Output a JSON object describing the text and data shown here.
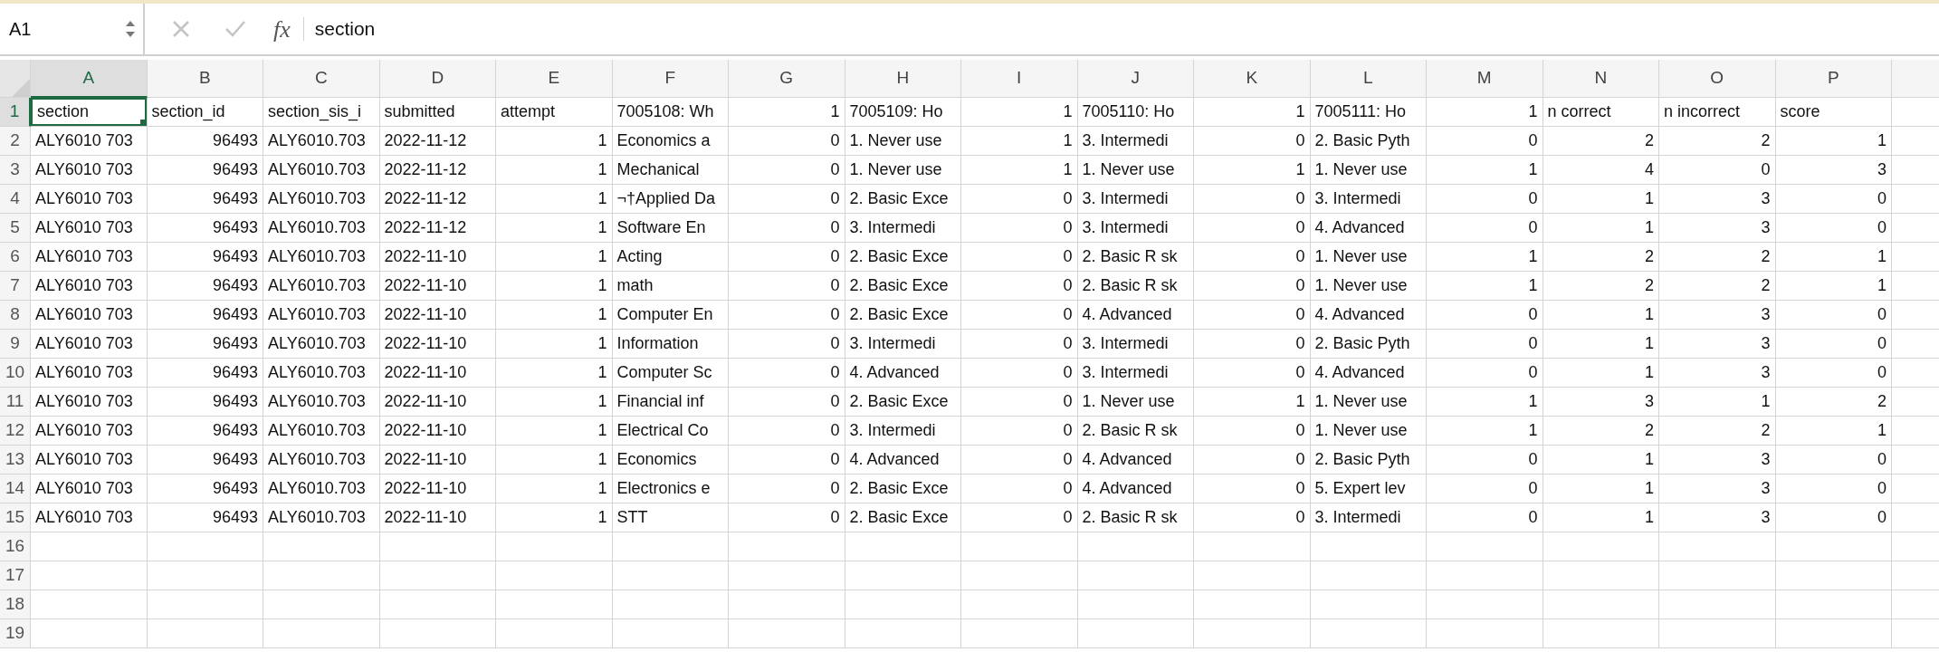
{
  "formula_bar": {
    "name_box": "A1",
    "function_label": "fx",
    "formula": "section"
  },
  "columns": [
    {
      "label": "A",
      "selected": true
    },
    {
      "label": "B",
      "selected": false
    },
    {
      "label": "C",
      "selected": false
    },
    {
      "label": "D",
      "selected": false
    },
    {
      "label": "E",
      "selected": false
    },
    {
      "label": "F",
      "selected": false
    },
    {
      "label": "G",
      "selected": false
    },
    {
      "label": "H",
      "selected": false
    },
    {
      "label": "I",
      "selected": false
    },
    {
      "label": "J",
      "selected": false
    },
    {
      "label": "K",
      "selected": false
    },
    {
      "label": "L",
      "selected": false
    },
    {
      "label": "M",
      "selected": false
    },
    {
      "label": "N",
      "selected": false
    },
    {
      "label": "O",
      "selected": false
    },
    {
      "label": "P",
      "selected": false
    }
  ],
  "rows": [
    {
      "number": "1",
      "selected": true,
      "cells": [
        {
          "text": "section",
          "kind": "text"
        },
        {
          "text": "section_id",
          "kind": "text"
        },
        {
          "text": "section_sis_i",
          "kind": "text"
        },
        {
          "text": "submitted",
          "kind": "text"
        },
        {
          "text": "attempt",
          "kind": "text"
        },
        {
          "text": "7005108: Wh",
          "kind": "text"
        },
        {
          "text": "1",
          "kind": "number"
        },
        {
          "text": "7005109: Ho",
          "kind": "text"
        },
        {
          "text": "1",
          "kind": "number"
        },
        {
          "text": "7005110: Ho",
          "kind": "text"
        },
        {
          "text": "1",
          "kind": "number"
        },
        {
          "text": "7005111: Ho",
          "kind": "text"
        },
        {
          "text": "1",
          "kind": "number"
        },
        {
          "text": "n correct",
          "kind": "text"
        },
        {
          "text": "n incorrect",
          "kind": "text"
        },
        {
          "text": "score",
          "kind": "text"
        }
      ]
    },
    {
      "number": "2",
      "selected": false,
      "cells": [
        {
          "text": "ALY6010 703",
          "kind": "text"
        },
        {
          "text": "96493",
          "kind": "number"
        },
        {
          "text": "ALY6010.703",
          "kind": "text"
        },
        {
          "text": "2022-11-12",
          "kind": "text"
        },
        {
          "text": "1",
          "kind": "number"
        },
        {
          "text": "Economics a",
          "kind": "text"
        },
        {
          "text": "0",
          "kind": "number"
        },
        {
          "text": "1. Never use",
          "kind": "text"
        },
        {
          "text": "1",
          "kind": "number"
        },
        {
          "text": "3. Intermedi",
          "kind": "text"
        },
        {
          "text": "0",
          "kind": "number"
        },
        {
          "text": "2. Basic Pyth",
          "kind": "text"
        },
        {
          "text": "0",
          "kind": "number"
        },
        {
          "text": "2",
          "kind": "number"
        },
        {
          "text": "2",
          "kind": "number"
        },
        {
          "text": "1",
          "kind": "number"
        }
      ]
    },
    {
      "number": "3",
      "selected": false,
      "cells": [
        {
          "text": "ALY6010 703",
          "kind": "text"
        },
        {
          "text": "96493",
          "kind": "number"
        },
        {
          "text": "ALY6010.703",
          "kind": "text"
        },
        {
          "text": "2022-11-12",
          "kind": "text"
        },
        {
          "text": "1",
          "kind": "number"
        },
        {
          "text": "Mechanical",
          "kind": "text"
        },
        {
          "text": "0",
          "kind": "number"
        },
        {
          "text": "1. Never use",
          "kind": "text"
        },
        {
          "text": "1",
          "kind": "number"
        },
        {
          "text": "1. Never use",
          "kind": "text"
        },
        {
          "text": "1",
          "kind": "number"
        },
        {
          "text": "1. Never use",
          "kind": "text"
        },
        {
          "text": "1",
          "kind": "number"
        },
        {
          "text": "4",
          "kind": "number"
        },
        {
          "text": "0",
          "kind": "number"
        },
        {
          "text": "3",
          "kind": "number"
        }
      ]
    },
    {
      "number": "4",
      "selected": false,
      "cells": [
        {
          "text": "ALY6010 703",
          "kind": "text"
        },
        {
          "text": "96493",
          "kind": "number"
        },
        {
          "text": "ALY6010.703",
          "kind": "text"
        },
        {
          "text": "2022-11-12",
          "kind": "text"
        },
        {
          "text": "1",
          "kind": "number"
        },
        {
          "text": "¬†Applied Da",
          "kind": "text"
        },
        {
          "text": "0",
          "kind": "number"
        },
        {
          "text": "2. Basic Exce",
          "kind": "text"
        },
        {
          "text": "0",
          "kind": "number"
        },
        {
          "text": "3. Intermedi",
          "kind": "text"
        },
        {
          "text": "0",
          "kind": "number"
        },
        {
          "text": "3. Intermedi",
          "kind": "text"
        },
        {
          "text": "0",
          "kind": "number"
        },
        {
          "text": "1",
          "kind": "number"
        },
        {
          "text": "3",
          "kind": "number"
        },
        {
          "text": "0",
          "kind": "number"
        }
      ]
    },
    {
      "number": "5",
      "selected": false,
      "cells": [
        {
          "text": "ALY6010 703",
          "kind": "text"
        },
        {
          "text": "96493",
          "kind": "number"
        },
        {
          "text": "ALY6010.703",
          "kind": "text"
        },
        {
          "text": "2022-11-12",
          "kind": "text"
        },
        {
          "text": "1",
          "kind": "number"
        },
        {
          "text": "Software En",
          "kind": "text"
        },
        {
          "text": "0",
          "kind": "number"
        },
        {
          "text": "3. Intermedi",
          "kind": "text"
        },
        {
          "text": "0",
          "kind": "number"
        },
        {
          "text": "3. Intermedi",
          "kind": "text"
        },
        {
          "text": "0",
          "kind": "number"
        },
        {
          "text": "4. Advanced",
          "kind": "text"
        },
        {
          "text": "0",
          "kind": "number"
        },
        {
          "text": "1",
          "kind": "number"
        },
        {
          "text": "3",
          "kind": "number"
        },
        {
          "text": "0",
          "kind": "number"
        }
      ]
    },
    {
      "number": "6",
      "selected": false,
      "cells": [
        {
          "text": "ALY6010 703",
          "kind": "text"
        },
        {
          "text": "96493",
          "kind": "number"
        },
        {
          "text": "ALY6010.703",
          "kind": "text"
        },
        {
          "text": "2022-11-10",
          "kind": "text"
        },
        {
          "text": "1",
          "kind": "number"
        },
        {
          "text": "Acting",
          "kind": "text"
        },
        {
          "text": "0",
          "kind": "number"
        },
        {
          "text": "2. Basic Exce",
          "kind": "text"
        },
        {
          "text": "0",
          "kind": "number"
        },
        {
          "text": "2. Basic R sk",
          "kind": "text"
        },
        {
          "text": "0",
          "kind": "number"
        },
        {
          "text": "1. Never use",
          "kind": "text"
        },
        {
          "text": "1",
          "kind": "number"
        },
        {
          "text": "2",
          "kind": "number"
        },
        {
          "text": "2",
          "kind": "number"
        },
        {
          "text": "1",
          "kind": "number"
        }
      ]
    },
    {
      "number": "7",
      "selected": false,
      "cells": [
        {
          "text": "ALY6010 703",
          "kind": "text"
        },
        {
          "text": "96493",
          "kind": "number"
        },
        {
          "text": "ALY6010.703",
          "kind": "text"
        },
        {
          "text": "2022-11-10",
          "kind": "text"
        },
        {
          "text": "1",
          "kind": "number"
        },
        {
          "text": "math",
          "kind": "text"
        },
        {
          "text": "0",
          "kind": "number"
        },
        {
          "text": "2. Basic Exce",
          "kind": "text"
        },
        {
          "text": "0",
          "kind": "number"
        },
        {
          "text": "2. Basic R sk",
          "kind": "text"
        },
        {
          "text": "0",
          "kind": "number"
        },
        {
          "text": "1. Never use",
          "kind": "text"
        },
        {
          "text": "1",
          "kind": "number"
        },
        {
          "text": "2",
          "kind": "number"
        },
        {
          "text": "2",
          "kind": "number"
        },
        {
          "text": "1",
          "kind": "number"
        }
      ]
    },
    {
      "number": "8",
      "selected": false,
      "cells": [
        {
          "text": "ALY6010 703",
          "kind": "text"
        },
        {
          "text": "96493",
          "kind": "number"
        },
        {
          "text": "ALY6010.703",
          "kind": "text"
        },
        {
          "text": "2022-11-10",
          "kind": "text"
        },
        {
          "text": "1",
          "kind": "number"
        },
        {
          "text": "Computer En",
          "kind": "text"
        },
        {
          "text": "0",
          "kind": "number"
        },
        {
          "text": "2. Basic Exce",
          "kind": "text"
        },
        {
          "text": "0",
          "kind": "number"
        },
        {
          "text": "4. Advanced",
          "kind": "text"
        },
        {
          "text": "0",
          "kind": "number"
        },
        {
          "text": "4. Advanced",
          "kind": "text"
        },
        {
          "text": "0",
          "kind": "number"
        },
        {
          "text": "1",
          "kind": "number"
        },
        {
          "text": "3",
          "kind": "number"
        },
        {
          "text": "0",
          "kind": "number"
        }
      ]
    },
    {
      "number": "9",
      "selected": false,
      "cells": [
        {
          "text": "ALY6010 703",
          "kind": "text"
        },
        {
          "text": "96493",
          "kind": "number"
        },
        {
          "text": "ALY6010.703",
          "kind": "text"
        },
        {
          "text": "2022-11-10",
          "kind": "text"
        },
        {
          "text": "1",
          "kind": "number"
        },
        {
          "text": "Information",
          "kind": "text"
        },
        {
          "text": "0",
          "kind": "number"
        },
        {
          "text": "3. Intermedi",
          "kind": "text"
        },
        {
          "text": "0",
          "kind": "number"
        },
        {
          "text": "3. Intermedi",
          "kind": "text"
        },
        {
          "text": "0",
          "kind": "number"
        },
        {
          "text": "2. Basic Pyth",
          "kind": "text"
        },
        {
          "text": "0",
          "kind": "number"
        },
        {
          "text": "1",
          "kind": "number"
        },
        {
          "text": "3",
          "kind": "number"
        },
        {
          "text": "0",
          "kind": "number"
        }
      ]
    },
    {
      "number": "10",
      "selected": false,
      "cells": [
        {
          "text": "ALY6010 703",
          "kind": "text"
        },
        {
          "text": "96493",
          "kind": "number"
        },
        {
          "text": "ALY6010.703",
          "kind": "text"
        },
        {
          "text": "2022-11-10",
          "kind": "text"
        },
        {
          "text": "1",
          "kind": "number"
        },
        {
          "text": "Computer Sc",
          "kind": "text"
        },
        {
          "text": "0",
          "kind": "number"
        },
        {
          "text": "4. Advanced",
          "kind": "text"
        },
        {
          "text": "0",
          "kind": "number"
        },
        {
          "text": "3. Intermedi",
          "kind": "text"
        },
        {
          "text": "0",
          "kind": "number"
        },
        {
          "text": "4. Advanced",
          "kind": "text"
        },
        {
          "text": "0",
          "kind": "number"
        },
        {
          "text": "1",
          "kind": "number"
        },
        {
          "text": "3",
          "kind": "number"
        },
        {
          "text": "0",
          "kind": "number"
        }
      ]
    },
    {
      "number": "11",
      "selected": false,
      "cells": [
        {
          "text": "ALY6010 703",
          "kind": "text"
        },
        {
          "text": "96493",
          "kind": "number"
        },
        {
          "text": "ALY6010.703",
          "kind": "text"
        },
        {
          "text": "2022-11-10",
          "kind": "text"
        },
        {
          "text": "1",
          "kind": "number"
        },
        {
          "text": "Financial inf",
          "kind": "text"
        },
        {
          "text": "0",
          "kind": "number"
        },
        {
          "text": "2. Basic Exce",
          "kind": "text"
        },
        {
          "text": "0",
          "kind": "number"
        },
        {
          "text": "1. Never use",
          "kind": "text"
        },
        {
          "text": "1",
          "kind": "number"
        },
        {
          "text": "1. Never use",
          "kind": "text"
        },
        {
          "text": "1",
          "kind": "number"
        },
        {
          "text": "3",
          "kind": "number"
        },
        {
          "text": "1",
          "kind": "number"
        },
        {
          "text": "2",
          "kind": "number"
        }
      ]
    },
    {
      "number": "12",
      "selected": false,
      "cells": [
        {
          "text": "ALY6010 703",
          "kind": "text"
        },
        {
          "text": "96493",
          "kind": "number"
        },
        {
          "text": "ALY6010.703",
          "kind": "text"
        },
        {
          "text": "2022-11-10",
          "kind": "text"
        },
        {
          "text": "1",
          "kind": "number"
        },
        {
          "text": "Electrical Co",
          "kind": "text"
        },
        {
          "text": "0",
          "kind": "number"
        },
        {
          "text": "3. Intermedi",
          "kind": "text"
        },
        {
          "text": "0",
          "kind": "number"
        },
        {
          "text": "2. Basic R sk",
          "kind": "text"
        },
        {
          "text": "0",
          "kind": "number"
        },
        {
          "text": "1. Never use",
          "kind": "text"
        },
        {
          "text": "1",
          "kind": "number"
        },
        {
          "text": "2",
          "kind": "number"
        },
        {
          "text": "2",
          "kind": "number"
        },
        {
          "text": "1",
          "kind": "number"
        }
      ]
    },
    {
      "number": "13",
      "selected": false,
      "cells": [
        {
          "text": "ALY6010 703",
          "kind": "text"
        },
        {
          "text": "96493",
          "kind": "number"
        },
        {
          "text": "ALY6010.703",
          "kind": "text"
        },
        {
          "text": "2022-11-10",
          "kind": "text"
        },
        {
          "text": "1",
          "kind": "number"
        },
        {
          "text": "Economics",
          "kind": "text"
        },
        {
          "text": "0",
          "kind": "number"
        },
        {
          "text": "4. Advanced",
          "kind": "text"
        },
        {
          "text": "0",
          "kind": "number"
        },
        {
          "text": "4. Advanced",
          "kind": "text"
        },
        {
          "text": "0",
          "kind": "number"
        },
        {
          "text": "2. Basic Pyth",
          "kind": "text"
        },
        {
          "text": "0",
          "kind": "number"
        },
        {
          "text": "1",
          "kind": "number"
        },
        {
          "text": "3",
          "kind": "number"
        },
        {
          "text": "0",
          "kind": "number"
        }
      ]
    },
    {
      "number": "14",
      "selected": false,
      "cells": [
        {
          "text": "ALY6010 703",
          "kind": "text"
        },
        {
          "text": "96493",
          "kind": "number"
        },
        {
          "text": "ALY6010.703",
          "kind": "text"
        },
        {
          "text": "2022-11-10",
          "kind": "text"
        },
        {
          "text": "1",
          "kind": "number"
        },
        {
          "text": "Electronics e",
          "kind": "text"
        },
        {
          "text": "0",
          "kind": "number"
        },
        {
          "text": "2. Basic Exce",
          "kind": "text"
        },
        {
          "text": "0",
          "kind": "number"
        },
        {
          "text": "4. Advanced",
          "kind": "text"
        },
        {
          "text": "0",
          "kind": "number"
        },
        {
          "text": "5. Expert lev",
          "kind": "text"
        },
        {
          "text": "0",
          "kind": "number"
        },
        {
          "text": "1",
          "kind": "number"
        },
        {
          "text": "3",
          "kind": "number"
        },
        {
          "text": "0",
          "kind": "number"
        }
      ]
    },
    {
      "number": "15",
      "selected": false,
      "cells": [
        {
          "text": "ALY6010 703",
          "kind": "text"
        },
        {
          "text": "96493",
          "kind": "number"
        },
        {
          "text": "ALY6010.703",
          "kind": "text"
        },
        {
          "text": "2022-11-10",
          "kind": "text"
        },
        {
          "text": "1",
          "kind": "number"
        },
        {
          "text": "STT",
          "kind": "text"
        },
        {
          "text": "0",
          "kind": "number"
        },
        {
          "text": "2. Basic Exce",
          "kind": "text"
        },
        {
          "text": "0",
          "kind": "number"
        },
        {
          "text": "2. Basic R sk",
          "kind": "text"
        },
        {
          "text": "0",
          "kind": "number"
        },
        {
          "text": "3. Intermedi",
          "kind": "text"
        },
        {
          "text": "0",
          "kind": "number"
        },
        {
          "text": "1",
          "kind": "number"
        },
        {
          "text": "3",
          "kind": "number"
        },
        {
          "text": "0",
          "kind": "number"
        }
      ]
    },
    {
      "number": "16",
      "selected": false
    },
    {
      "number": "17",
      "selected": false
    },
    {
      "number": "18",
      "selected": false
    },
    {
      "number": "19",
      "selected": false
    }
  ]
}
